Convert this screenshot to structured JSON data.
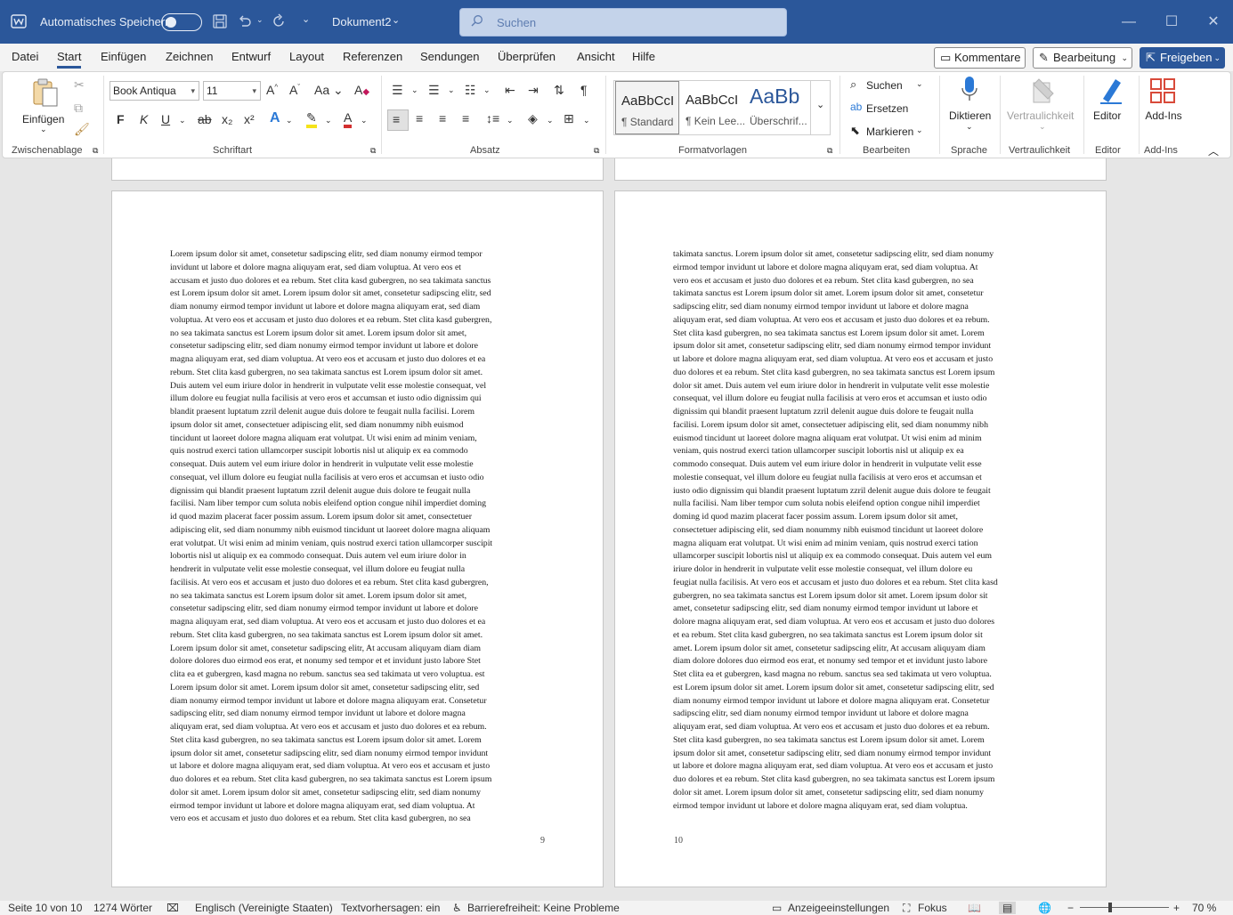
{
  "titlebar": {
    "autosave_label": "Automatisches Speichern",
    "doc_title": "Dokument2",
    "search_placeholder": "Suchen"
  },
  "menu": {
    "items": [
      "Datei",
      "Start",
      "Einfügen",
      "Zeichnen",
      "Entwurf",
      "Layout",
      "Referenzen",
      "Sendungen",
      "Überprüfen",
      "Ansicht",
      "Hilfe"
    ],
    "active": "Start",
    "comments": "Kommentare",
    "editing": "Bearbeitung",
    "share": "Freigeben"
  },
  "ribbon": {
    "clipboard": {
      "paste": "Einfügen",
      "label": "Zwischenablage"
    },
    "font": {
      "family": "Book Antiqua",
      "size": "11",
      "label": "Schriftart",
      "bold": "F",
      "italic": "K",
      "underline": "U",
      "strike": "ab",
      "sub": "x₂",
      "sup": "x²"
    },
    "paragraph": {
      "label": "Absatz"
    },
    "styles": {
      "label": "Formatvorlagen",
      "items": [
        {
          "preview": "AaBbCcI",
          "name": "¶ Standard"
        },
        {
          "preview": "AaBbCcI",
          "name": "¶ Kein Lee..."
        },
        {
          "preview": "AaBb",
          "name": "Überschrif..."
        }
      ]
    },
    "editing": {
      "find": "Suchen",
      "replace": "Ersetzen",
      "select": "Markieren",
      "label": "Bearbeiten"
    },
    "voice": {
      "dictate": "Diktieren",
      "label": "Sprache"
    },
    "sensitivity": {
      "button": "Vertraulichkeit",
      "label": "Vertraulichkeit"
    },
    "editor": {
      "button": "Editor",
      "label": "Editor"
    },
    "addins": {
      "button": "Add-Ins",
      "label": "Add-Ins"
    }
  },
  "pages": [
    {
      "number": "9",
      "lines": [
        "Lorem ipsum dolor sit amet, consetetur sadipscing elitr, sed diam nonumy eirmod tempor",
        "invidunt ut labore et dolore magna aliquyam erat, sed diam voluptua. At vero eos et",
        "accusam et justo duo dolores et ea rebum. Stet clita kasd gubergren, no sea takimata sanctus",
        "est Lorem ipsum dolor sit amet. Lorem ipsum dolor sit amet, consetetur sadipscing elitr, sed",
        "diam nonumy eirmod tempor invidunt ut labore et dolore magna aliquyam erat, sed diam",
        "voluptua. At vero eos et accusam et justo duo dolores et ea rebum. Stet clita kasd gubergren,",
        "no sea takimata sanctus est Lorem ipsum dolor sit amet. Lorem ipsum dolor sit amet,",
        "consetetur sadipscing elitr, sed diam nonumy eirmod tempor invidunt ut labore et dolore",
        "magna aliquyam erat, sed diam voluptua. At vero eos et accusam et justo duo dolores et ea",
        "rebum. Stet clita kasd gubergren, no sea takimata sanctus est Lorem ipsum dolor sit amet.",
        "Duis autem vel eum iriure dolor in hendrerit in vulputate velit esse molestie consequat, vel",
        "illum dolore eu feugiat nulla facilisis at vero eros et accumsan et iusto odio dignissim qui",
        "blandit praesent luptatum zzril delenit augue duis dolore te feugait nulla facilisi. Lorem",
        "ipsum dolor sit amet, consectetuer adipiscing elit, sed diam nonummy nibh euismod",
        "tincidunt ut laoreet dolore magna aliquam erat volutpat. Ut wisi enim ad minim veniam,",
        "quis nostrud exerci tation ullamcorper suscipit lobortis nisl ut aliquip ex ea commodo",
        "consequat. Duis autem vel eum iriure dolor in hendrerit in vulputate velit esse molestie",
        "consequat, vel illum dolore eu feugiat nulla facilisis at vero eros et accumsan et iusto odio",
        "dignissim qui blandit praesent luptatum zzril delenit augue duis dolore te feugait nulla",
        "facilisi. Nam liber tempor cum soluta nobis eleifend option congue nihil imperdiet doming",
        "id quod mazim placerat facer possim assum. Lorem ipsum dolor sit amet, consectetuer",
        "adipiscing elit, sed diam nonummy nibh euismod tincidunt ut laoreet dolore magna aliquam",
        "erat volutpat. Ut wisi enim ad minim veniam, quis nostrud exerci tation ullamcorper suscipit",
        "lobortis nisl ut aliquip ex ea commodo consequat. Duis autem vel eum iriure dolor in",
        "hendrerit in vulputate velit esse molestie consequat, vel illum dolore eu feugiat nulla",
        "facilisis. At vero eos et accusam et justo duo dolores et ea rebum. Stet clita kasd gubergren,",
        "no sea takimata sanctus est Lorem ipsum dolor sit amet. Lorem ipsum dolor sit amet,",
        "consetetur sadipscing elitr, sed diam nonumy eirmod tempor invidunt ut labore et dolore",
        "magna aliquyam erat, sed diam voluptua. At vero eos et accusam et justo duo dolores et ea",
        "rebum. Stet clita kasd gubergren, no sea takimata sanctus est Lorem ipsum dolor sit amet.",
        "Lorem ipsum dolor sit amet, consetetur sadipscing elitr, At accusam aliquyam diam diam",
        "dolore dolores duo eirmod eos erat, et nonumy sed tempor et et invidunt justo labore Stet",
        "clita ea et gubergren, kasd magna no rebum. sanctus sea sed takimata ut vero voluptua. est",
        "Lorem ipsum dolor sit amet. Lorem ipsum dolor sit amet, consetetur sadipscing elitr, sed",
        "diam nonumy eirmod tempor invidunt ut labore et dolore magna aliquyam erat. Consetetur",
        "sadipscing elitr, sed diam nonumy eirmod tempor invidunt ut labore et dolore magna",
        "aliquyam erat, sed diam voluptua. At vero eos et accusam et justo duo dolores et ea rebum.",
        "Stet clita kasd gubergren, no sea takimata sanctus est Lorem ipsum dolor sit amet. Lorem",
        "ipsum dolor sit amet, consetetur sadipscing elitr, sed diam nonumy eirmod tempor invidunt",
        "ut labore et dolore magna aliquyam erat, sed diam voluptua. At vero eos et accusam et justo",
        "duo dolores et ea rebum. Stet clita kasd gubergren, no sea takimata sanctus est Lorem ipsum",
        "dolor sit amet. Lorem ipsum dolor sit amet, consetetur sadipscing elitr, sed diam nonumy",
        "eirmod tempor invidunt ut labore et dolore magna aliquyam erat, sed diam voluptua. At",
        "vero eos et accusam et justo duo dolores et ea rebum. Stet clita kasd gubergren, no sea"
      ]
    },
    {
      "number": "10",
      "lines": [
        "takimata sanctus. Lorem ipsum dolor sit amet, consetetur sadipscing elitr, sed diam nonumy",
        "eirmod tempor invidunt ut labore et dolore magna aliquyam erat, sed diam voluptua. At",
        "vero eos et accusam et justo duo dolores et ea rebum. Stet clita kasd gubergren, no sea",
        "takimata sanctus est Lorem ipsum dolor sit amet. Lorem ipsum dolor sit amet, consetetur",
        "sadipscing elitr, sed diam nonumy eirmod tempor invidunt ut labore et dolore magna",
        "aliquyam erat, sed diam voluptua. At vero eos et accusam et justo duo dolores et ea rebum.",
        "Stet clita kasd gubergren, no sea takimata sanctus est Lorem ipsum dolor sit amet. Lorem",
        "ipsum dolor sit amet, consetetur sadipscing elitr, sed diam nonumy eirmod tempor invidunt",
        "ut labore et dolore magna aliquyam erat, sed diam voluptua. At vero eos et accusam et justo",
        "duo dolores et ea rebum. Stet clita kasd gubergren, no sea takimata sanctus est Lorem ipsum",
        "dolor sit amet. Duis autem vel eum iriure dolor in hendrerit in vulputate velit esse molestie",
        "consequat, vel illum dolore eu feugiat nulla facilisis at vero eros et accumsan et iusto odio",
        "dignissim qui blandit praesent luptatum zzril delenit augue duis dolore te feugait nulla",
        "facilisi. Lorem ipsum dolor sit amet, consectetuer adipiscing elit, sed diam nonummy nibh",
        "euismod tincidunt ut laoreet dolore magna aliquam erat volutpat. Ut wisi enim ad minim",
        "veniam, quis nostrud exerci tation ullamcorper suscipit lobortis nisl ut aliquip ex ea",
        "commodo consequat. Duis autem vel eum iriure dolor in hendrerit in vulputate velit esse",
        "molestie consequat, vel illum dolore eu feugiat nulla facilisis at vero eros et accumsan et",
        "iusto odio dignissim qui blandit praesent luptatum zzril delenit augue duis dolore te feugait",
        "nulla facilisi. Nam liber tempor cum soluta nobis eleifend option congue nihil imperdiet",
        "doming id quod mazim placerat facer possim assum. Lorem ipsum dolor sit amet,",
        "consectetuer adipiscing elit, sed diam nonummy nibh euismod tincidunt ut laoreet dolore",
        "magna aliquam erat volutpat. Ut wisi enim ad minim veniam, quis nostrud exerci tation",
        "ullamcorper suscipit lobortis nisl ut aliquip ex ea commodo consequat. Duis autem vel eum",
        "iriure dolor in hendrerit in vulputate velit esse molestie consequat, vel illum dolore eu",
        "feugiat nulla facilisis. At vero eos et accusam et justo duo dolores et ea rebum. Stet clita kasd",
        "gubergren, no sea takimata sanctus est Lorem ipsum dolor sit amet. Lorem ipsum dolor sit",
        "amet, consetetur sadipscing elitr, sed diam nonumy eirmod tempor invidunt ut labore et",
        "dolore magna aliquyam erat, sed diam voluptua. At vero eos et accusam et justo duo dolores",
        "et ea rebum. Stet clita kasd gubergren, no sea takimata sanctus est Lorem ipsum dolor sit",
        "amet. Lorem ipsum dolor sit amet, consetetur sadipscing elitr, At accusam aliquyam diam",
        "diam dolore dolores duo eirmod eos erat, et nonumy sed tempor et et invidunt justo labore",
        "Stet clita ea et gubergren, kasd magna no rebum. sanctus sea sed takimata ut vero voluptua.",
        "est Lorem ipsum dolor sit amet. Lorem ipsum dolor sit amet, consetetur sadipscing elitr, sed",
        "diam nonumy eirmod tempor invidunt ut labore et dolore magna aliquyam erat. Consetetur",
        "sadipscing elitr, sed diam nonumy eirmod tempor invidunt ut labore et dolore magna",
        "aliquyam erat, sed diam voluptua. At vero eos et accusam et justo duo dolores et ea rebum.",
        "Stet clita kasd gubergren, no sea takimata sanctus est Lorem ipsum dolor sit amet. Lorem",
        "ipsum dolor sit amet, consetetur sadipscing elitr, sed diam nonumy eirmod tempor invidunt",
        "ut labore et dolore magna aliquyam erat, sed diam voluptua. At vero eos et accusam et justo",
        "duo dolores et ea rebum. Stet clita kasd gubergren, no sea takimata sanctus est Lorem ipsum",
        "dolor sit amet. Lorem ipsum dolor sit amet, consetetur sadipscing elitr, sed diam nonumy",
        "eirmod tempor invidunt ut labore et dolore magna aliquyam erat, sed diam voluptua."
      ]
    }
  ],
  "statusbar": {
    "page": "Seite 10 von 10",
    "words": "1274 Wörter",
    "language": "Englisch (Vereinigte Staaten)",
    "predictions": "Textvorhersagen: ein",
    "accessibility": "Barrierefreiheit: Keine Probleme",
    "display_settings": "Anzeigeeinstellungen",
    "focus": "Fokus",
    "zoom": "70 %",
    "zoom_minus": "−",
    "zoom_plus": "+"
  }
}
